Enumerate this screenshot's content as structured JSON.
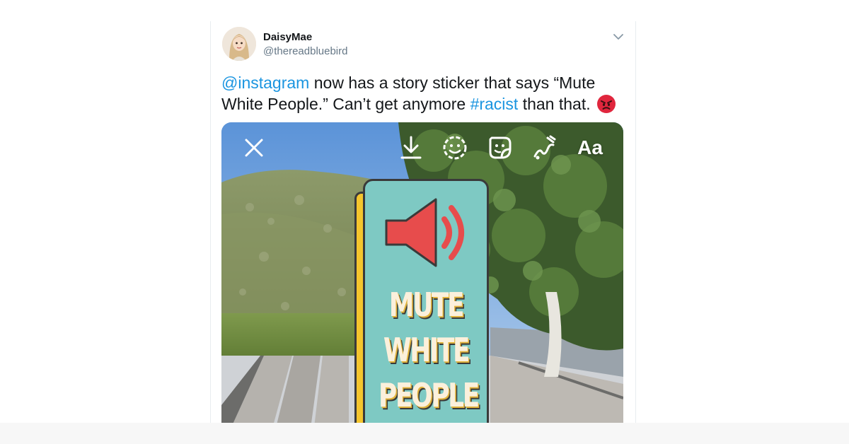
{
  "tweet": {
    "display_name": "DaisyMae",
    "handle": "@thereadbluebird",
    "text_parts": {
      "mention": "@instagram",
      "part1": " now has a story sticker that says “Mute White People.” Can’t get anymore ",
      "hashtag": "#racist",
      "part2": " than that. "
    },
    "emoji": "pouting-face"
  },
  "story_toolbar": {
    "close_icon": "close-icon",
    "download_icon": "download-icon",
    "face_effects_icon": "face-effects-icon",
    "sticker_icon": "sticker-icon",
    "draw_icon": "draw-icon",
    "text_tool_label": "Aa"
  },
  "sticker": {
    "line1": "MUTE",
    "line2": "WHITE",
    "line3": "PEOPLE",
    "icon": "speaker-icon"
  },
  "colors": {
    "link": "#1b95e0",
    "sticker_bg": "#7ec9c3",
    "sticker_accent": "#e74c4c",
    "sticker_spine": "#f5c52d"
  }
}
